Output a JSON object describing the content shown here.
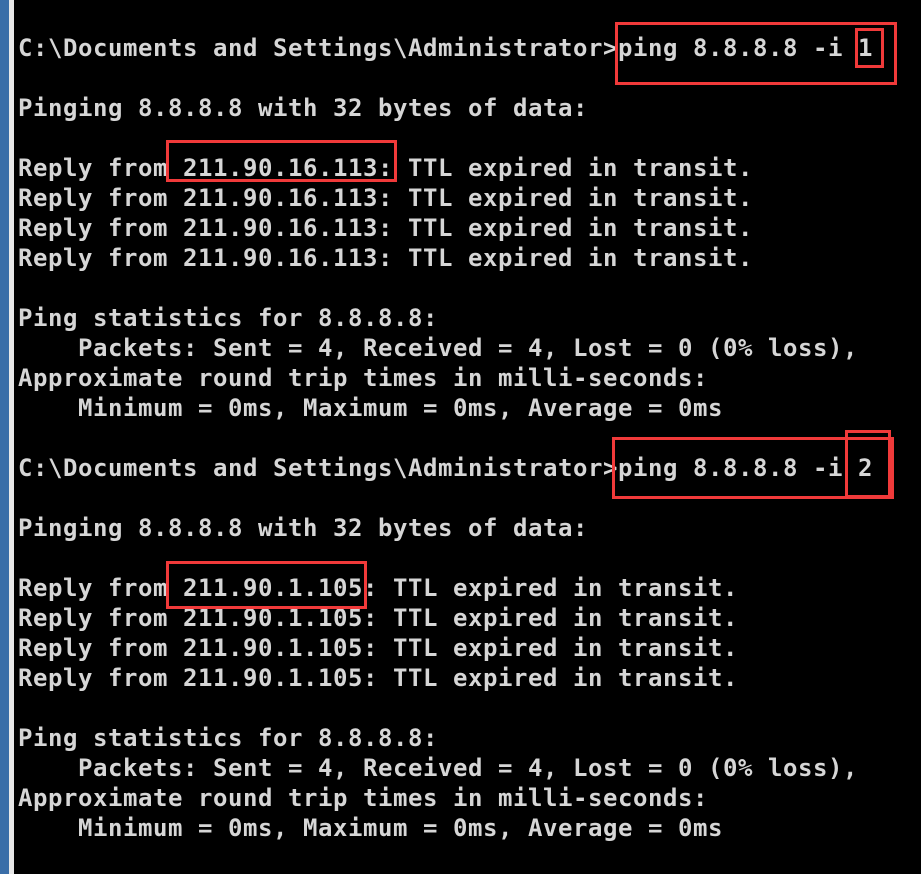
{
  "terminal": {
    "lines": [
      "C:\\Documents and Settings\\Administrator>ping 8.8.8.8 -i 1",
      "",
      "Pinging 8.8.8.8 with 32 bytes of data:",
      "",
      "Reply from 211.90.16.113: TTL expired in transit.",
      "Reply from 211.90.16.113: TTL expired in transit.",
      "Reply from 211.90.16.113: TTL expired in transit.",
      "Reply from 211.90.16.113: TTL expired in transit.",
      "",
      "Ping statistics for 8.8.8.8:",
      "    Packets: Sent = 4, Received = 4, Lost = 0 (0% loss),",
      "Approximate round trip times in milli-seconds:",
      "    Minimum = 0ms, Maximum = 0ms, Average = 0ms",
      "",
      "C:\\Documents and Settings\\Administrator>ping 8.8.8.8 -i 2",
      "",
      "Pinging 8.8.8.8 with 32 bytes of data:",
      "",
      "Reply from 211.90.1.105: TTL expired in transit.",
      "Reply from 211.90.1.105: TTL expired in transit.",
      "Reply from 211.90.1.105: TTL expired in transit.",
      "Reply from 211.90.1.105: TTL expired in transit.",
      "",
      "Ping statistics for 8.8.8.8:",
      "    Packets: Sent = 4, Received = 4, Lost = 0 (0% loss),",
      "Approximate round trip times in milli-seconds:",
      "    Minimum = 0ms, Maximum = 0ms, Average = 0ms"
    ]
  },
  "colors": {
    "background": "#000000",
    "text": "#d6d6d6",
    "highlight": "#f03a3a"
  }
}
